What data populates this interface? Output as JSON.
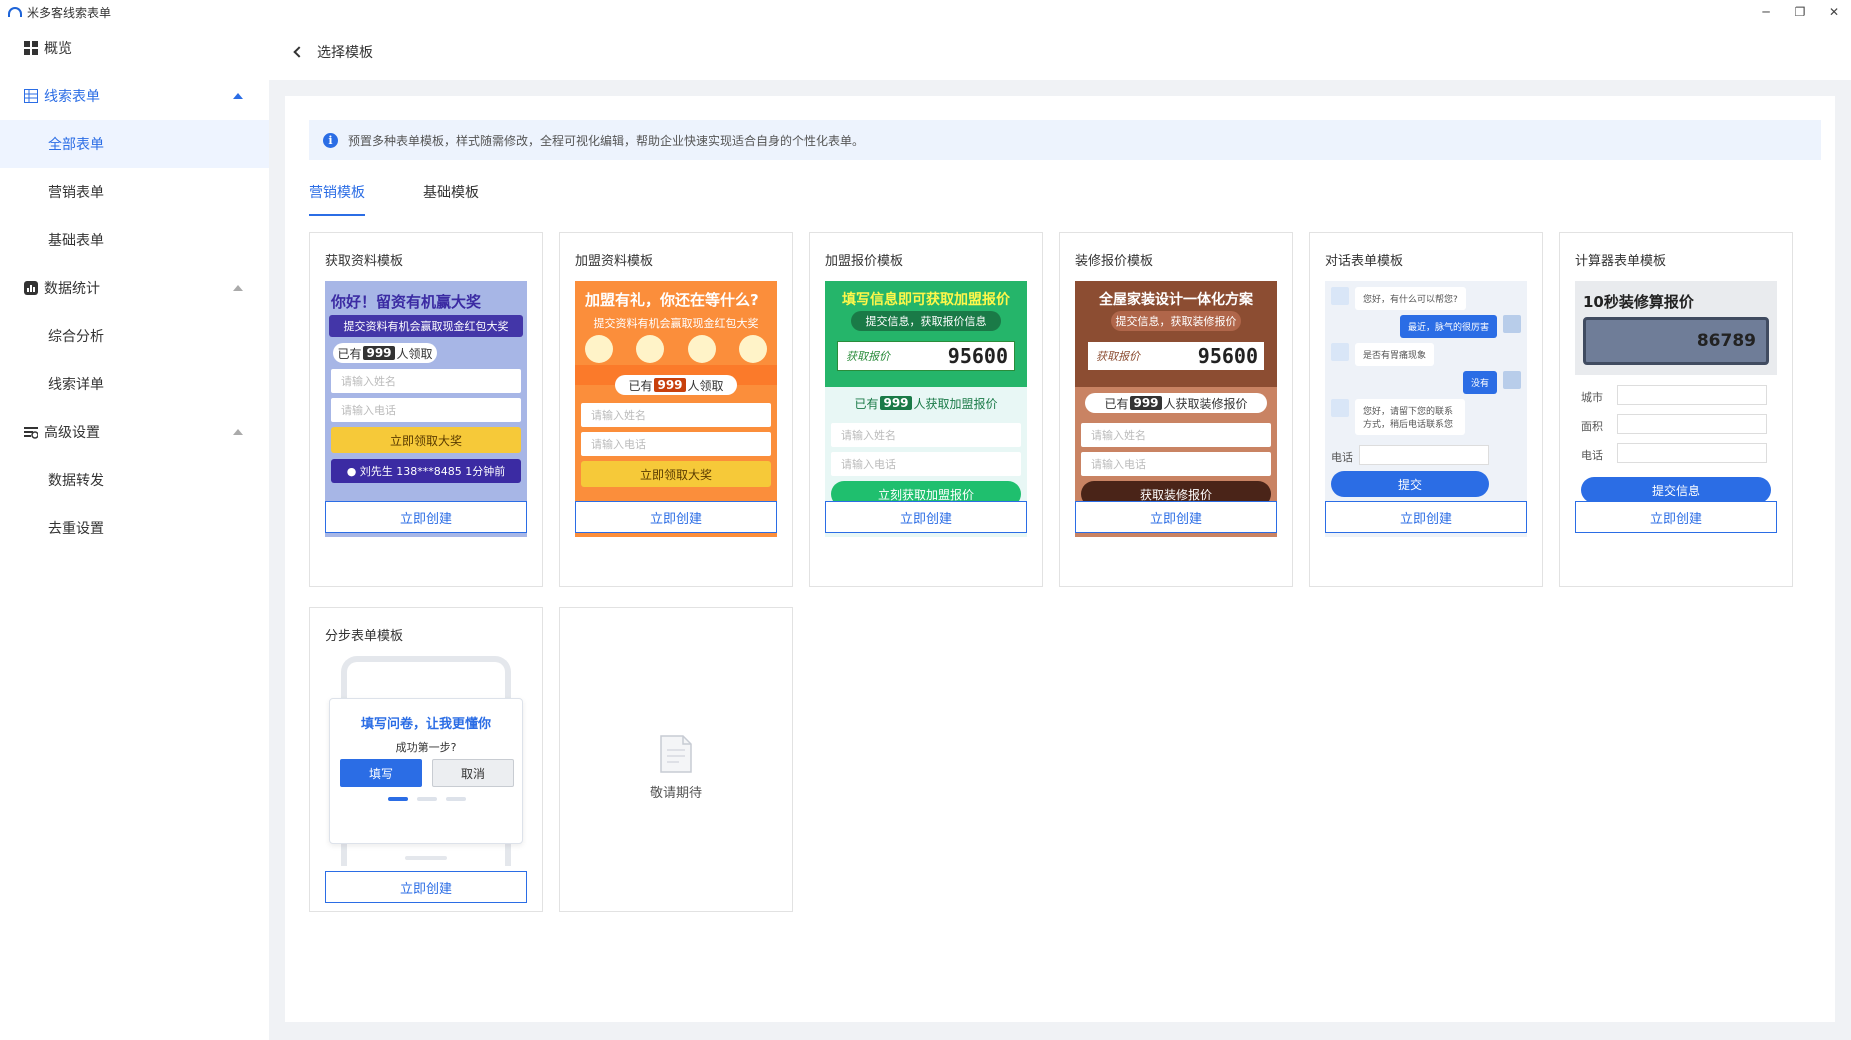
{
  "app": {
    "title": "米多客线索表单",
    "min": "─",
    "restore": "❐",
    "close": "✕"
  },
  "sidebar": {
    "overview": "概览",
    "lead_forms": "线索表单",
    "all_forms": "全部表单",
    "marketing_forms": "营销表单",
    "basic_forms": "基础表单",
    "data_stats": "数据统计",
    "comprehensive": "综合分析",
    "lead_detail": "线索详单",
    "advanced": "高级设置",
    "forward": "数据转发",
    "dedupe": "去重设置"
  },
  "header": {
    "title": "选择模板"
  },
  "notice": "预置多种表单模板，样式随需修改，全程可视化编辑，帮助企业快速实现适合自身的个性化表单。",
  "tabs": [
    "营销模板",
    "基础模板"
  ],
  "create_label": "立即创建",
  "coming_soon": "敬请期待",
  "cards": [
    {
      "title": "获取资料模板",
      "head": "你好！留资有机赢大奖",
      "sub": "提交资料有机会赢取现金红包大奖",
      "pill_pre": "已有",
      "pill_num": "999",
      "pill_post": "人领取",
      "name_ph": "请输入姓名",
      "phone_ph": "请输入电话",
      "cta": "立即领取大奖",
      "ticker": "● 刘先生  138***8485  1分钟前"
    },
    {
      "title": "加盟资料模板",
      "head": "加盟有礼，你还在等什么?",
      "sub": "提交资料有机会赢取现金红包大奖",
      "pill_pre": "已有",
      "pill_num": "999",
      "pill_post": "人领取",
      "name_ph": "请输入姓名",
      "phone_ph": "请输入电话",
      "cta": "立即领取大奖"
    },
    {
      "title": "加盟报价模板",
      "head": "填写信息即可获取加盟报价",
      "sub": "提交信息，获取报价信息",
      "num_label": "获取报价",
      "num": "95600",
      "pill_pre": "已有",
      "pill_num": "999",
      "pill_post": "人获取加盟报价",
      "name_ph": "请输入姓名",
      "phone_ph": "请输入电话",
      "cta": "立刻获取加盟报价"
    },
    {
      "title": "装修报价模板",
      "head": "全屋家装设计一体化方案",
      "sub": "提交信息，获取装修报价",
      "num_label": "获取报价",
      "num": "95600",
      "pill_pre": "已有",
      "pill_num": "999",
      "pill_post": "人获取装修报价",
      "name_ph": "请输入姓名",
      "phone_ph": "请输入电话",
      "cta": "获取装修报价"
    },
    {
      "title": "对话表单模板",
      "b1": "您好，有什么可以帮您?",
      "b2": "最近，脉气的很厉害",
      "b3": "是否有胃痛现象",
      "b4": "没有",
      "b5": "您好，请留下您的联系方式，稍后电话联系您",
      "phone_label": "电话",
      "cta": "提交"
    },
    {
      "title": "计算器表单模板",
      "head": "10秒装修算报价",
      "num": "86789",
      "f1": "城市",
      "f2": "面积",
      "f3": "电话",
      "cta": "提交信息"
    },
    {
      "title": "分步表单模板",
      "head": "填写问卷，让我更懂你",
      "sub": "成功第一步?",
      "fill": "填写",
      "cancel": "取消"
    }
  ],
  "colors": {
    "accent": "#2b6de5"
  }
}
